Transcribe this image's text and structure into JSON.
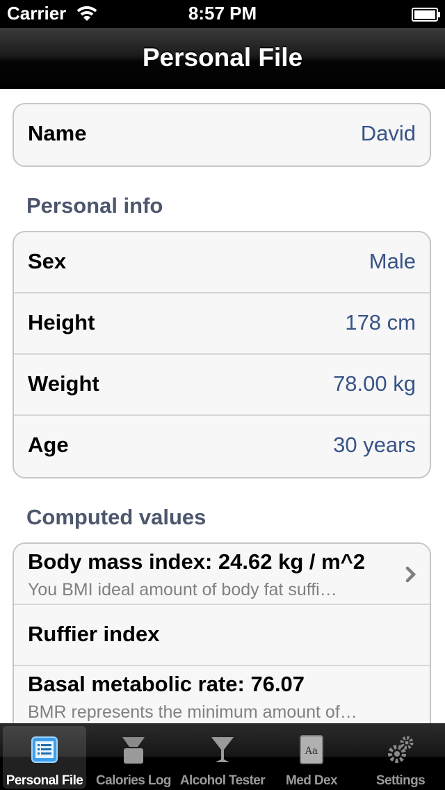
{
  "status_bar": {
    "carrier": "Carrier",
    "time": "8:57 PM"
  },
  "nav": {
    "title": "Personal File"
  },
  "name_group": {
    "label": "Name",
    "value": "David"
  },
  "personal_info": {
    "header": "Personal info",
    "rows": [
      {
        "label": "Sex",
        "value": "Male"
      },
      {
        "label": "Height",
        "value": "178 cm"
      },
      {
        "label": "Weight",
        "value": "78.00 kg"
      },
      {
        "label": "Age",
        "value": "30 years"
      }
    ]
  },
  "computed": {
    "header": "Computed values",
    "rows": [
      {
        "title": "Body mass index: 24.62 kg / m^2",
        "subtitle": "You BMI ideal amount of body fat suffi…"
      },
      {
        "title": "Ruffier index"
      },
      {
        "title": "Basal metabolic rate: 76.07",
        "subtitle": "BMR represents the minimum amount of…"
      }
    ]
  },
  "tabs": [
    {
      "label": "Personal File",
      "icon": "personal-file-icon",
      "selected": true
    },
    {
      "label": "Calories Log",
      "icon": "scale-icon"
    },
    {
      "label": "Alcohol Tester",
      "icon": "cocktail-glass-icon"
    },
    {
      "label": "Med Dex",
      "icon": "book-icon"
    },
    {
      "label": "Settings",
      "icon": "gears-icon"
    }
  ],
  "colors": {
    "value_blue": "#385487",
    "section_header": "#4c566c",
    "tab_selected_icon": "#3ea0ea"
  }
}
